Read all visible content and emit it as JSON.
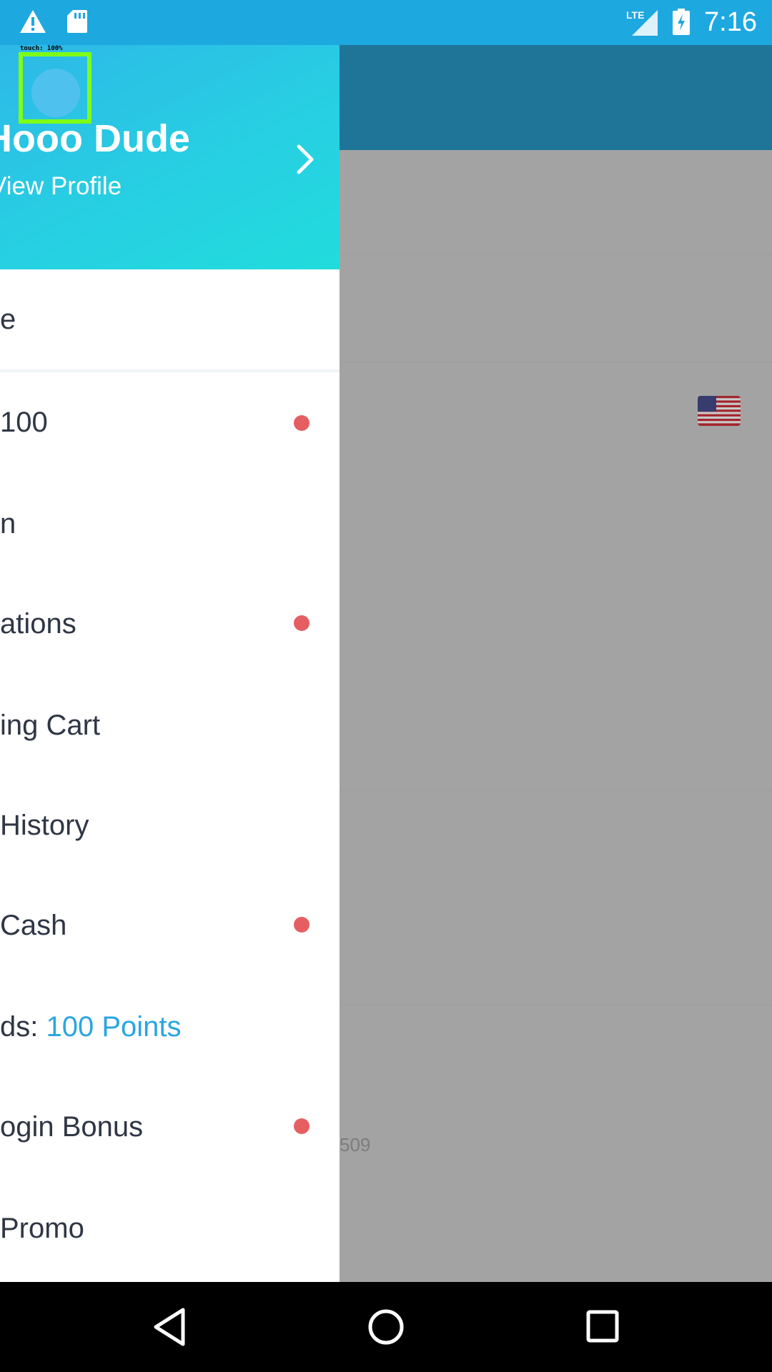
{
  "status_bar": {
    "time": "7:16",
    "network": "LTE",
    "icons": [
      "warning-icon",
      "sd-card-icon",
      "lte-signal-icon",
      "battery-charging-icon"
    ]
  },
  "drawer": {
    "touch_label": "touch: 100%",
    "user_name": "Hooo Dude",
    "view_profile": "View Profile",
    "items": [
      {
        "label": "e",
        "dot": false
      },
      {
        "label": "100",
        "dot": true
      },
      {
        "label": "n",
        "dot": false
      },
      {
        "label": "ations",
        "dot": true
      },
      {
        "label": "ing Cart",
        "dot": false
      },
      {
        "label": "History",
        "dot": false
      },
      {
        "label": "Cash",
        "dot": true
      },
      {
        "label": "ds: ",
        "highlight": "100 Points",
        "dot": false
      },
      {
        "label": "ogin Bonus",
        "dot": true
      },
      {
        "label": "Promo",
        "dot": false
      }
    ]
  },
  "background": {
    "faded_text": "509"
  },
  "colors": {
    "status_bar": "#1ea8e0",
    "toolbar": "#1f7598",
    "scrim": "#a3a3a3",
    "dot": "#e55f62",
    "highlight": "#2aa6e0",
    "menu_text": "#2f3645"
  },
  "nav_bar": {
    "icons": [
      "back-icon",
      "home-icon",
      "recents-icon"
    ]
  }
}
